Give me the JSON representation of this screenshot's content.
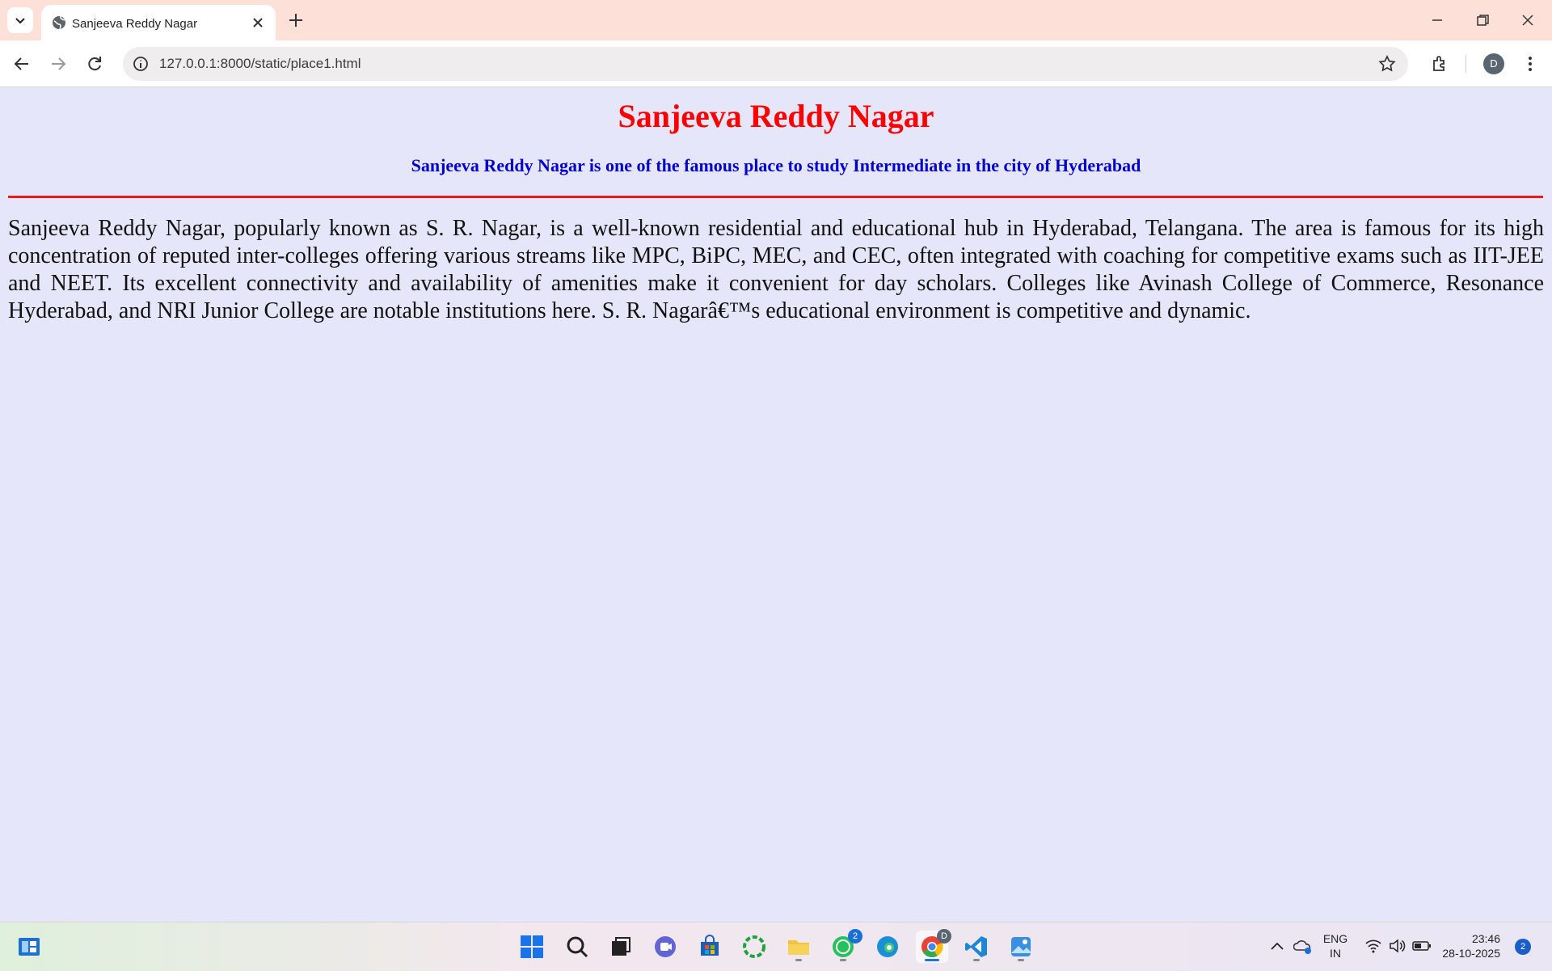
{
  "browser": {
    "tab_title": "Sanjeeva Reddy Nagar",
    "url": "127.0.0.1:8000/static/place1.html",
    "profile_initial": "D"
  },
  "page": {
    "heading": "Sanjeeva Reddy Nagar",
    "subheading": "Sanjeeva Reddy Nagar is one of the famous place to study Intermediate in the city of Hyderabad",
    "paragraph": "Sanjeeva Reddy Nagar, popularly known as S. R. Nagar, is a well-known residential and educational hub in Hyderabad, Telangana. The area is famous for its high concentration of reputed inter-colleges offering various streams like MPC, BiPC, MEC, and CEC, often integrated with coaching for competitive exams such as IIT-JEE and NEET. Its excellent connectivity and availability of amenities make it convenient for day scholars. Colleges like Avinash College of Commerce, Resonance Hyderabad, and NRI Junior College are notable institutions here. S. R. Nagarâ€™s educational environment is competitive and dynamic.",
    "heading_color": "#ff0000",
    "subheading_color": "#0000cd",
    "background_color": "#e6e6fa"
  },
  "taskbar": {
    "apps": [
      "start-icon",
      "search-icon",
      "task-view-icon",
      "teams-icon",
      "store-icon",
      "copilot-icon",
      "file-explorer-icon",
      "whatsapp-icon",
      "edge-icon",
      "chrome-icon",
      "vscode-icon",
      "photos-icon"
    ],
    "whatsapp_badge": "2",
    "chrome_profile_badge": "D",
    "language_line1": "ENG",
    "language_line2": "IN",
    "time": "23:46",
    "date": "28-10-2025",
    "notification_count": "2"
  }
}
